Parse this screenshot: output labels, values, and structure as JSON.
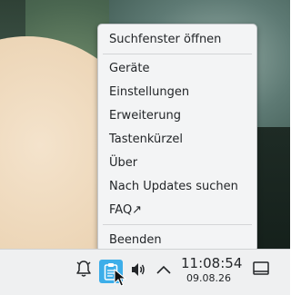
{
  "menu": {
    "items": [
      "Suchfenster öffnen",
      "Geräte",
      "Einstellungen",
      "Erweiterung",
      "Tastenkürzel",
      "Über",
      "Nach Updates suchen",
      "FAQ↗",
      "Beenden"
    ]
  },
  "tray": {
    "icons": [
      "notification-bell-icon",
      "clipboard-icon",
      "volume-icon",
      "chevron-up-icon",
      "show-desktop-icon"
    ],
    "accent": "#3daee9"
  },
  "clock": {
    "time": "11:08:54",
    "date": "09.08.26"
  }
}
